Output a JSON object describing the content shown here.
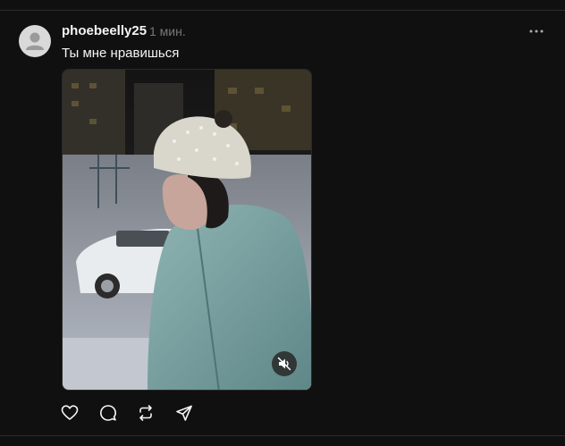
{
  "post": {
    "author": "phoebeelly25",
    "time": "1 мин.",
    "text": "Ты мне нравишься"
  },
  "icons": {
    "avatar": "default-user-avatar",
    "more": "more-horizontal-icon",
    "mute": "speaker-muted-icon",
    "like": "heart-icon",
    "reply": "speech-bubble-icon",
    "repost": "repost-arrows-icon",
    "share": "send-paper-plane-icon"
  },
  "colors": {
    "background": "#101010",
    "text": "#f3f5f7",
    "muted": "#777777"
  }
}
